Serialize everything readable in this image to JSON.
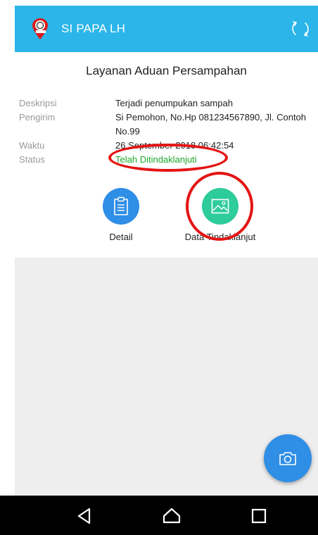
{
  "app": {
    "title": "SI PAPA LH",
    "logo_text": "SI PAPA",
    "accent": "#2bb5e9"
  },
  "page": {
    "title": "Layanan Aduan Persampahan"
  },
  "details": {
    "deskripsi": {
      "label": "Deskripsi",
      "value": "Terjadi penumpukan sampah"
    },
    "pengirim": {
      "label": "Pengirim",
      "value": "Si Pemohon, No.Hp 081234567890, Jl. Contoh No.99"
    },
    "waktu": {
      "label": "Waktu",
      "value": "26 September 2018 06:42:54"
    },
    "status": {
      "label": "Status",
      "value": "Telah Ditindaklanjuti",
      "color": "#1da82a"
    }
  },
  "actions": {
    "detail": {
      "label": "Detail",
      "icon": "clipboard-icon",
      "color": "#2f8ee6"
    },
    "data_tindaklanjut": {
      "label": "Data Tindaklanjut",
      "icon": "image-icon",
      "color": "#2ecc9a"
    }
  },
  "fab": {
    "icon": "camera-icon",
    "color": "#2f8ee6"
  },
  "system_nav": {
    "back": "back-icon",
    "home": "home-icon",
    "recents": "recents-icon"
  }
}
